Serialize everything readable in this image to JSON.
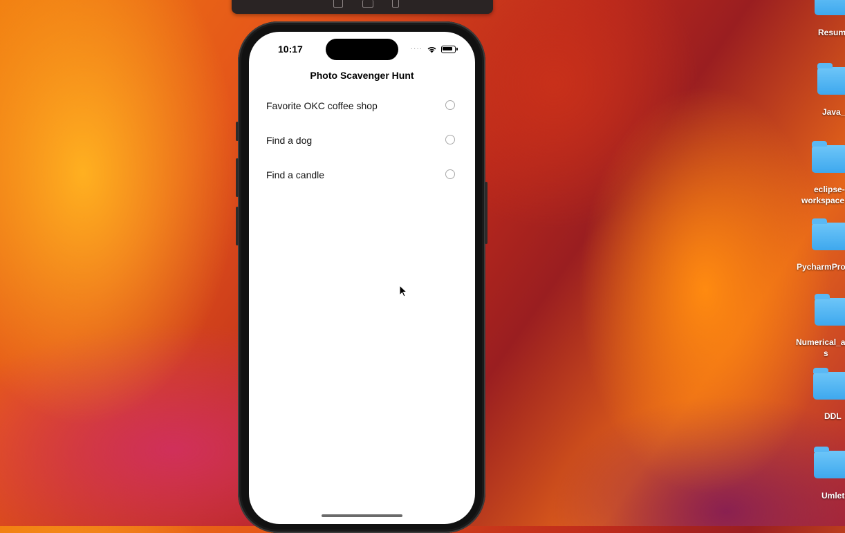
{
  "simulator": {
    "toolbar_icons": [
      "home-icon",
      "screenshot-icon",
      "rotate-icon"
    ],
    "status_bar": {
      "time": "10:17",
      "signal": "····",
      "wifi_icon": "wifi-icon",
      "battery_icon": "battery-icon"
    },
    "nav_title": "Photo Scavenger Hunt",
    "tasks": [
      {
        "label": "Favorite OKC coffee shop",
        "completed": false
      },
      {
        "label": "Find a dog",
        "completed": false
      },
      {
        "label": "Find a candle",
        "completed": false
      }
    ]
  },
  "desktop": {
    "items": [
      {
        "label": "Resum",
        "type": "folder"
      },
      {
        "label": "Java_",
        "type": "folder"
      },
      {
        "label": "eclipse-",
        "label2": "workspace",
        "type": "folder"
      },
      {
        "label": "PycharmPro",
        "type": "folder"
      },
      {
        "label": "Numerical_a",
        "label2": "s",
        "type": "folder"
      },
      {
        "label": "DDL",
        "type": "folder"
      },
      {
        "label": "Umlet",
        "type": "folder"
      }
    ]
  }
}
